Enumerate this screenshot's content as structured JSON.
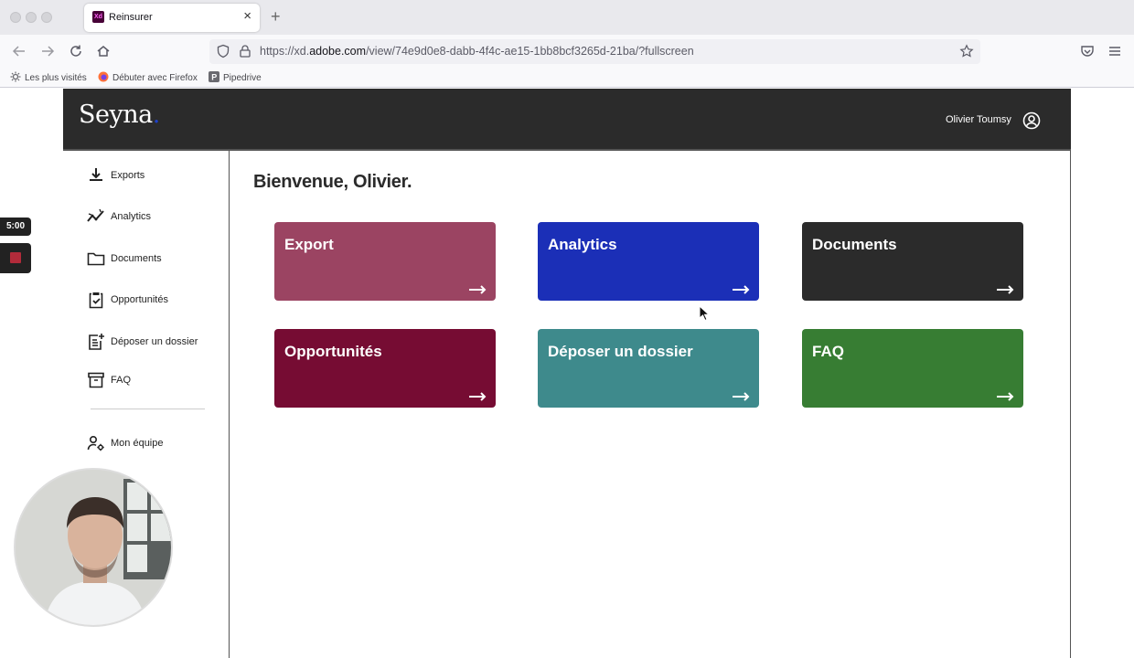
{
  "browser": {
    "tab_title": "Reinsurer",
    "url_prefix": "https://xd.",
    "url_domain": "adobe.com",
    "url_path": "/view/74e9d0e8-dabb-4f4c-ae15-1bb8bcf3265d-21ba/?fullscreen",
    "bookmarks": [
      "Les plus visités",
      "Débuter avec Firefox",
      "Pipedrive"
    ]
  },
  "app": {
    "logo": "Seyna",
    "logo_dot": ".",
    "user_name": "Olivier Toumsy",
    "welcome": "Bienvenue, Olivier.",
    "sidebar": {
      "items": [
        {
          "label": "Exports",
          "icon": "download-icon"
        },
        {
          "label": "Analytics",
          "icon": "analytics-icon"
        },
        {
          "label": "Documents",
          "icon": "folder-icon"
        },
        {
          "label": "Opportunités",
          "icon": "clipboard-check-icon"
        },
        {
          "label": "Déposer un dossier",
          "icon": "file-add-icon"
        },
        {
          "label": "FAQ",
          "icon": "archive-icon"
        }
      ],
      "team": {
        "label": "Mon équipe",
        "icon": "team-settings-icon"
      }
    },
    "cards": [
      {
        "title": "Export",
        "color": "#9b4462"
      },
      {
        "title": "Analytics",
        "color": "#1b2fb7"
      },
      {
        "title": "Documents",
        "color": "#2b2b2b"
      },
      {
        "title": "Opportunités",
        "color": "#760c33"
      },
      {
        "title": "Déposer un dossier",
        "color": "#3e8a8c"
      },
      {
        "title": "FAQ",
        "color": "#377d33"
      }
    ]
  },
  "recorder": {
    "timer": "5:00"
  }
}
